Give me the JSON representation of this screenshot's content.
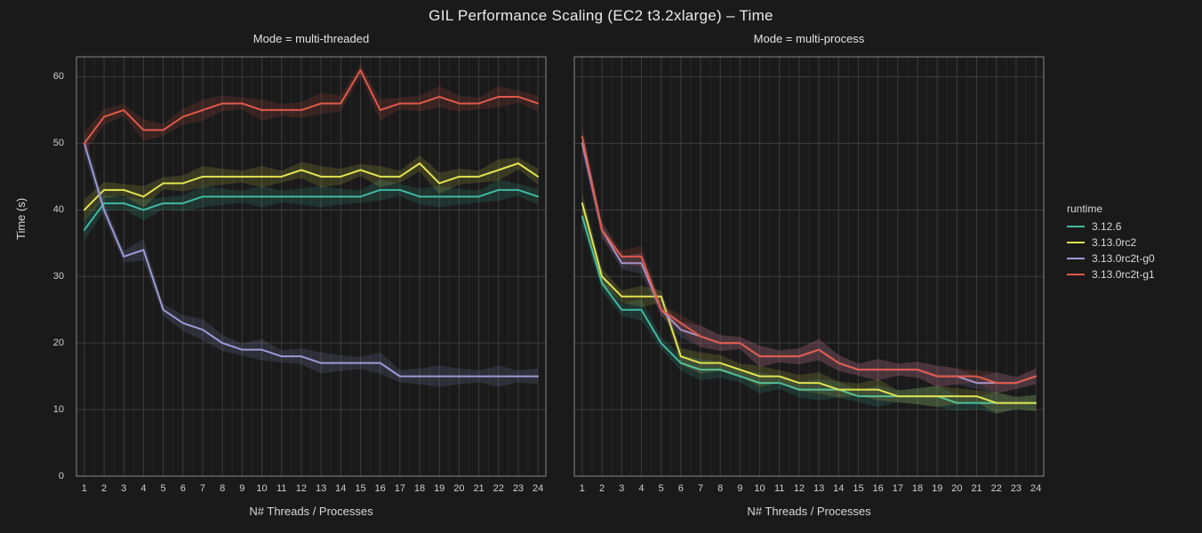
{
  "suptitle": "GIL Performance Scaling (EC2 t3.2xlarge) – Time",
  "panels": [
    {
      "key": "mt",
      "title": "Mode = multi-threaded"
    },
    {
      "key": "mp",
      "title": "Mode = multi-process"
    }
  ],
  "xlabel": "N# Threads / Processes",
  "ylabel": "Time (s)",
  "legend_title": "runtime",
  "legend": [
    {
      "name": "3.12.6",
      "color": "#3fbaa3"
    },
    {
      "name": "3.13.0rc2",
      "color": "#e2e251"
    },
    {
      "name": "3.13.0rc2t-g0",
      "color": "#9b9bd8"
    },
    {
      "name": "3.13.0rc2t-g1",
      "color": "#e05a4a"
    }
  ],
  "extras": {
    "grid_color": "#3c3c3c",
    "axis_color": "#888888"
  },
  "chart_data": {
    "type": "line",
    "facets": [
      "multi-threaded",
      "multi-process"
    ],
    "x": [
      1,
      2,
      3,
      4,
      5,
      6,
      7,
      8,
      9,
      10,
      11,
      12,
      13,
      14,
      15,
      16,
      17,
      18,
      19,
      20,
      21,
      22,
      23,
      24
    ],
    "xlabel": "N# Threads / Processes",
    "ylabel": "Time (s)",
    "ylim": [
      0,
      63
    ],
    "yticks": [
      0,
      10,
      20,
      30,
      40,
      50,
      60
    ],
    "title": "GIL Performance Scaling (EC2 t3.2xlarge) – Time",
    "series": {
      "multi-threaded": [
        {
          "name": "3.12.6",
          "color": "#3fbaa3",
          "values": [
            37,
            41,
            41,
            40,
            41,
            41,
            42,
            42,
            42,
            42,
            42,
            42,
            42,
            42,
            42,
            43,
            43,
            42,
            42,
            42,
            42,
            43,
            43,
            42
          ]
        },
        {
          "name": "3.13.0rc2",
          "color": "#e2e251",
          "values": [
            40,
            43,
            43,
            42,
            44,
            44,
            45,
            45,
            45,
            45,
            45,
            46,
            45,
            45,
            46,
            45,
            45,
            47,
            44,
            45,
            45,
            46,
            47,
            45
          ]
        },
        {
          "name": "3.13.0rc2t-g0",
          "color": "#9b9bd8",
          "values": [
            50,
            40,
            33,
            34,
            25,
            23,
            22,
            20,
            19,
            19,
            18,
            18,
            17,
            17,
            17,
            17,
            15,
            15,
            15,
            15,
            15,
            15,
            15,
            15
          ]
        },
        {
          "name": "3.13.0rc2t-g1",
          "color": "#e05a4a",
          "values": [
            50,
            54,
            55,
            52,
            52,
            54,
            55,
            56,
            56,
            55,
            55,
            55,
            56,
            56,
            61,
            55,
            56,
            56,
            57,
            56,
            56,
            57,
            57,
            56
          ]
        }
      ],
      "multi-process": [
        {
          "name": "3.12.6",
          "color": "#3fbaa3",
          "values": [
            39,
            29,
            25,
            25,
            20,
            17,
            16,
            16,
            15,
            14,
            14,
            13,
            13,
            13,
            12,
            12,
            12,
            12,
            12,
            11,
            11,
            11,
            11,
            11
          ]
        },
        {
          "name": "3.13.0rc2",
          "color": "#e2e251",
          "values": [
            41,
            30,
            27,
            27,
            27,
            18,
            17,
            17,
            16,
            15,
            15,
            14,
            14,
            13,
            13,
            13,
            12,
            12,
            12,
            12,
            12,
            11,
            11,
            11
          ]
        },
        {
          "name": "3.13.0rc2t-g0",
          "color": "#9b9bd8",
          "values": [
            50,
            37,
            32,
            32,
            25,
            22,
            21,
            20,
            20,
            18,
            18,
            18,
            19,
            17,
            16,
            16,
            16,
            16,
            15,
            15,
            14,
            14,
            14,
            15
          ]
        },
        {
          "name": "3.13.0rc2t-g1",
          "color": "#e05a4a",
          "values": [
            51,
            37,
            33,
            33,
            25,
            23,
            21,
            20,
            20,
            18,
            18,
            18,
            19,
            17,
            16,
            16,
            16,
            16,
            15,
            15,
            15,
            14,
            14,
            15
          ]
        }
      ]
    }
  }
}
